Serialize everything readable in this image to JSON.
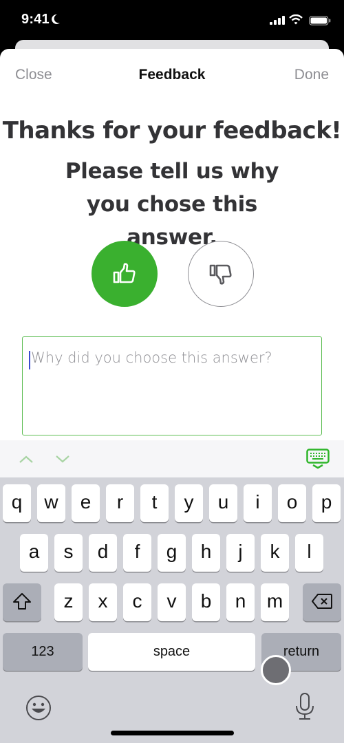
{
  "status_bar": {
    "time": "9:41",
    "icons": [
      "moon-icon",
      "cellular-signal-icon",
      "wifi-icon",
      "battery-icon"
    ]
  },
  "nav": {
    "close_label": "Close",
    "title": "Feedback",
    "done_label": "Done"
  },
  "content": {
    "heading": "Thanks for your feedback!",
    "subheading": "Please tell us why you chose this answer.",
    "vote": {
      "selected": "thumbs-up",
      "up_icon": "thumbs-up-icon",
      "down_icon": "thumbs-down-icon",
      "accent_color": "#3ab02f"
    },
    "answer_input": {
      "value": "",
      "placeholder": "Why did you choose this answer?"
    }
  },
  "accessory_bar": {
    "icons": [
      "chevron-up-icon",
      "chevron-down-icon",
      "keyboard-dismiss-icon"
    ]
  },
  "keyboard": {
    "row1": [
      "q",
      "w",
      "e",
      "r",
      "t",
      "y",
      "u",
      "i",
      "o",
      "p"
    ],
    "row2": [
      "a",
      "s",
      "d",
      "f",
      "g",
      "h",
      "j",
      "k",
      "l"
    ],
    "row3": [
      "z",
      "x",
      "c",
      "v",
      "b",
      "n",
      "m"
    ],
    "numbers_label": "123",
    "space_label": "space",
    "return_label": "return",
    "icons": [
      "shift-icon",
      "backspace-icon",
      "emoji-icon",
      "microphone-icon"
    ]
  }
}
